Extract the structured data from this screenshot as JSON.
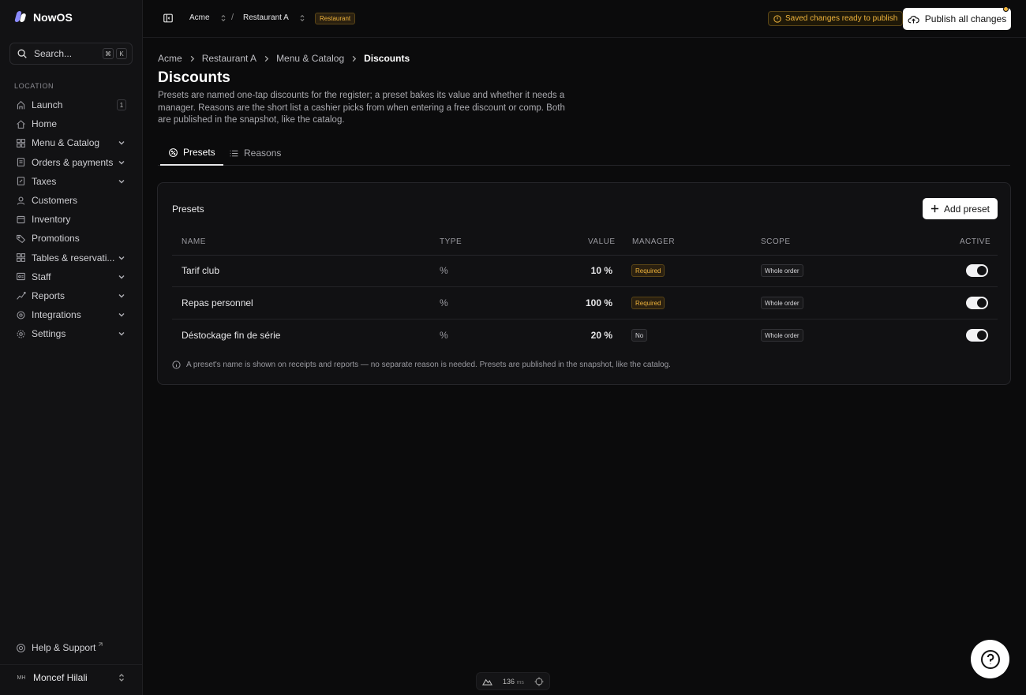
{
  "brand": {
    "name": "NowOS"
  },
  "search": {
    "placeholder": "Search...",
    "kbd1": "⌘",
    "kbd2": "K"
  },
  "sidebar": {
    "section_label": "LOCATION",
    "items": [
      {
        "label": "Launch",
        "icon": "rocket-icon",
        "count": "1"
      },
      {
        "label": "Home",
        "icon": "home-icon"
      },
      {
        "label": "Menu & Catalog",
        "icon": "grid-icon",
        "expandable": true
      },
      {
        "label": "Orders & payments",
        "icon": "receipt-icon",
        "expandable": true
      },
      {
        "label": "Taxes",
        "icon": "percent-doc-icon",
        "expandable": true
      },
      {
        "label": "Customers",
        "icon": "users-icon"
      },
      {
        "label": "Inventory",
        "icon": "box-icon"
      },
      {
        "label": "Promotions",
        "icon": "tag-icon"
      },
      {
        "label": "Tables & reservati...",
        "icon": "table-icon",
        "expandable": true
      },
      {
        "label": "Staff",
        "icon": "id-card-icon",
        "expandable": true
      },
      {
        "label": "Reports",
        "icon": "chart-icon",
        "expandable": true
      },
      {
        "label": "Integrations",
        "icon": "plug-icon",
        "expandable": true
      },
      {
        "label": "Settings",
        "icon": "gear-icon",
        "expandable": true
      }
    ],
    "help_label": "Help & Support",
    "user": {
      "initials": "MH",
      "name": "Moncef Hilali"
    }
  },
  "topbar": {
    "org": "Acme",
    "location": "Restaurant A",
    "location_tag": "Restaurant",
    "saved_status": "Saved changes ready to publish",
    "publish_label": "Publish all changes",
    "colors": {
      "accent_warning": "#f0b43c"
    }
  },
  "breadcrumb": [
    "Acme",
    "Restaurant A",
    "Menu & Catalog",
    "Discounts"
  ],
  "page": {
    "title": "Discounts",
    "description": "Presets are named one-tap discounts for the register; a preset bakes its value and whether it needs a manager. Reasons are the short list a cashier picks from when entering a free discount or comp. Both are published in the snapshot, like the catalog."
  },
  "tabs": [
    {
      "label": "Presets",
      "icon": "percent-badge-icon",
      "active": true
    },
    {
      "label": "Reasons",
      "icon": "list-icon",
      "active": false
    }
  ],
  "presets": {
    "card_title": "Presets",
    "add_label": "Add preset",
    "columns": {
      "name": "NAME",
      "type": "TYPE",
      "value": "VALUE",
      "manager": "MANAGER",
      "scope": "SCOPE",
      "active": "ACTIVE"
    },
    "rows": [
      {
        "name": "Tarif club",
        "type": "%",
        "value": "10 %",
        "manager": "Required",
        "scope": "Whole order",
        "active": true
      },
      {
        "name": "Repas personnel",
        "type": "%",
        "value": "100 %",
        "manager": "Required",
        "scope": "Whole order",
        "active": true
      },
      {
        "name": "Déstockage fin de série",
        "type": "%",
        "value": "20 %",
        "manager": "No",
        "scope": "Whole order",
        "active": true
      }
    ],
    "note": "A preset's name is shown on receipts and reports — no separate reason is needed. Presets are published in the snapshot, like the catalog."
  },
  "perf": {
    "value": "136",
    "unit": "ms"
  }
}
